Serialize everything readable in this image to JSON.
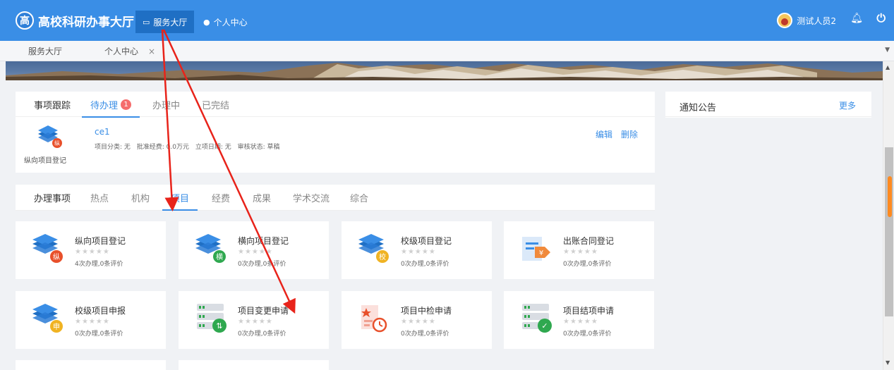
{
  "header": {
    "logo_glyph": "高",
    "app_title": "高校科研办事大厅",
    "nav": [
      {
        "label": "服务大厅",
        "icon": "monitor-icon"
      },
      {
        "label": "个人中心",
        "icon": "person-icon"
      }
    ],
    "user_name": "测试人员2"
  },
  "tabstrip": {
    "tabs": [
      {
        "label": "服务大厅"
      },
      {
        "label": "个人中心",
        "close": "×"
      }
    ]
  },
  "tracking": {
    "title": "事项跟踪",
    "tabs": [
      "待办理",
      "办理中",
      "已完结"
    ],
    "pending_count": "1",
    "item": {
      "icon_badge": "纵",
      "icon_label": "纵向项目登记",
      "name": "ce1",
      "meta": [
        "项目分类: 无",
        "批准经费: 0.0万元",
        "立项日期: 无",
        "审核状态: 草稿"
      ],
      "edit_label": "编辑",
      "delete_label": "删除"
    }
  },
  "notice": {
    "title": "通知公告",
    "more_label": "更多"
  },
  "services": {
    "title": "办理事项",
    "tabs": [
      "热点",
      "机构",
      "项目",
      "经费",
      "成果",
      "学术交流",
      "综合"
    ],
    "active_tab": "项目",
    "stars": "★★★★★",
    "cards": [
      {
        "name": "纵向项目登记",
        "stats": "4次办理,0条评价",
        "icon": "layers-icon",
        "badge": "纵",
        "badge_color": "#e8502b"
      },
      {
        "name": "横向项目登记",
        "stats": "0次办理,0条评价",
        "icon": "layers-icon",
        "badge": "横",
        "badge_color": "#2fa84f"
      },
      {
        "name": "校级项目登记",
        "stats": "0次办理,0条评价",
        "icon": "layers-icon",
        "badge": "校",
        "badge_color": "#f0b323"
      },
      {
        "name": "出账合同登记",
        "stats": "0次办理,0条评价",
        "icon": "contract-icon",
        "badge": "¥",
        "badge_color": "#f08a3c"
      },
      {
        "name": "校级项目申报",
        "stats": "0次办理,0条评价",
        "icon": "layers-icon",
        "badge": "申",
        "badge_color": "#f0b323"
      },
      {
        "name": "项目变更申请",
        "stats": "0次办理,0条评价",
        "icon": "server-icon",
        "badge": "⇅",
        "badge_color": "#2fa84f"
      },
      {
        "name": "项目中检申请",
        "stats": "0次办理,0条评价",
        "icon": "document-clock-icon",
        "badge": "",
        "badge_color": "#e8502b"
      },
      {
        "name": "项目结项申请",
        "stats": "0次办理,0条评价",
        "icon": "server-check-icon",
        "badge": "✓",
        "badge_color": "#2fa84f"
      }
    ]
  },
  "colors": {
    "primary": "#3a8ee6",
    "danger": "#f56c6c",
    "annotation": "#e8231a"
  }
}
